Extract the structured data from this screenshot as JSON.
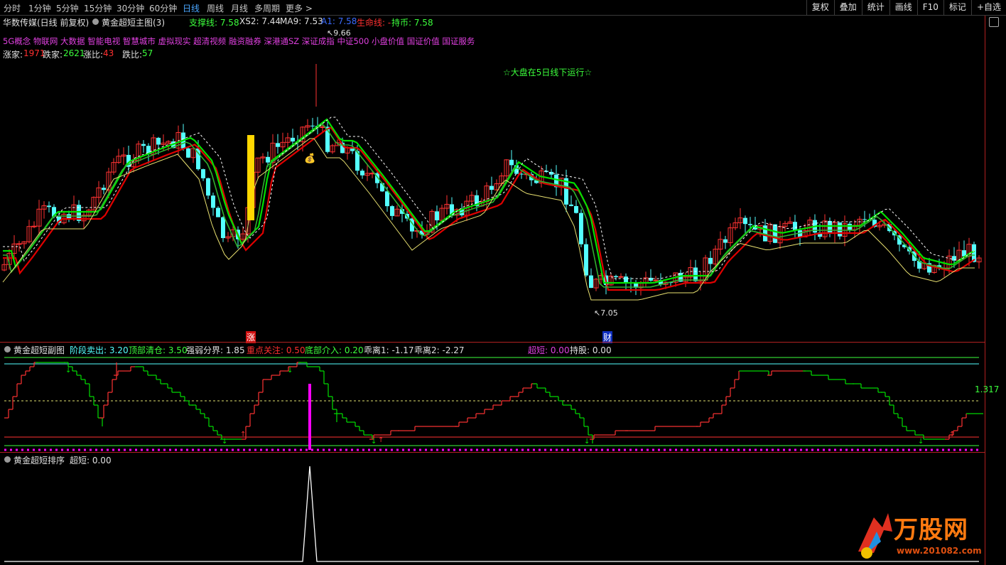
{
  "toolbar": {
    "periods": [
      "分时",
      "1分钟",
      "5分钟",
      "15分钟",
      "30分钟",
      "60分钟",
      "日线",
      "周线",
      "月线",
      "多周期",
      "更多 >"
    ],
    "active_period": "日线",
    "right_buttons": [
      "复权",
      "叠加",
      "统计",
      "画线",
      "F10",
      "标记",
      "+自选"
    ]
  },
  "main": {
    "stock_title": "华数传媒(日线 前复权)",
    "indicator_name": "黄金超短主图(3)",
    "support_label": "支撑线: 7.58",
    "xs2_label": "XS2: 7.44",
    "ma9_label": "MA9: 7.53",
    "a1_label": "A1: 7.58",
    "life_label": "生命线: -",
    "hold_label": "持币: 7.58",
    "concepts": "5G概念 物联网 大数据 智能电视 智慧城市 虚拟现实 超清视频 融资融券 深港通SZ 深证成指 中证500 小盘价值 国证价值 国证服务",
    "up_count_label": "涨家:",
    "up_count": "1971",
    "down_count_label": "跌家:",
    "down_count": "2621",
    "up_ratio_label": "涨比:",
    "up_ratio": "43",
    "down_ratio_label": "跌比:",
    "down_ratio": "57",
    "market_note": "☆大盘在5日线下运行☆",
    "high_label": "9.66",
    "low_label": "7.05",
    "marker_zhang": "涨",
    "marker_cai": "财"
  },
  "sub1": {
    "name": "黄金超短副图",
    "phase_sell": "阶段卖出: 3.20",
    "top_clear": "顶部清仓: 3.50",
    "strong_weak": "强弱分界: 1.85",
    "focus": "重点关注: 0.50",
    "bottom_enter": "底部介入: 0.20",
    "dev1": "乖离1: -1.17",
    "dev2": "乖离2: -2.27",
    "super_short": "超短: 0.00",
    "hold": "持股: 0.00",
    "right_value": "1.317"
  },
  "sub2": {
    "name": "黄金超短排序",
    "super_short": "超短: 0.00"
  },
  "watermark": {
    "brand": "万股网",
    "url": "www.201082.com"
  },
  "colors": {
    "up": "#ff3232",
    "down": "#54ffff",
    "ma_green": "#00e000",
    "ma_red": "#e00000",
    "yellow": "#ffd700",
    "magenta": "#ff00ff",
    "active_blue": "#4aa7ff"
  }
}
